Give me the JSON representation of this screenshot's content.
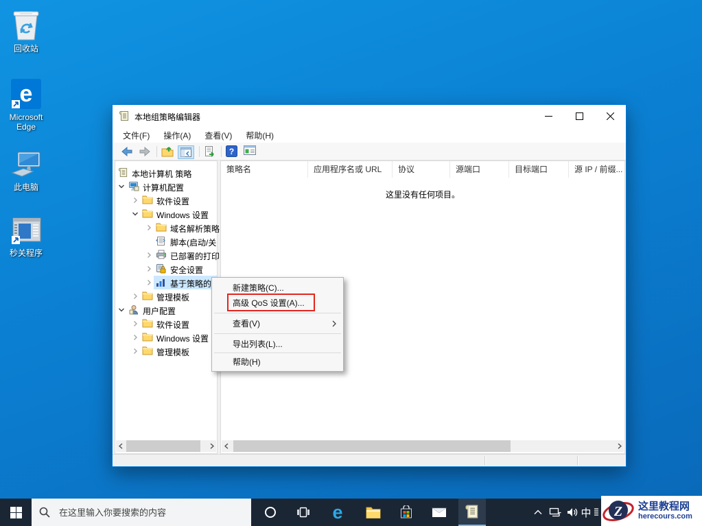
{
  "desktop": {
    "icons": [
      {
        "label": "回收站"
      },
      {
        "label": "Microsoft Edge"
      },
      {
        "label": "此电脑"
      },
      {
        "label": "秒关程序"
      }
    ]
  },
  "window": {
    "title": "本地组策略编辑器",
    "menubar": [
      {
        "label": "文件(F)"
      },
      {
        "label": "操作(A)"
      },
      {
        "label": "查看(V)"
      },
      {
        "label": "帮助(H)"
      }
    ],
    "tree": [
      {
        "label": "本地计算机 策略"
      },
      {
        "label": "计算机配置"
      },
      {
        "label": "软件设置"
      },
      {
        "label": "Windows 设置"
      },
      {
        "label": "域名解析策略"
      },
      {
        "label": "脚本(启动/关"
      },
      {
        "label": "已部署的打印"
      },
      {
        "label": "安全设置"
      },
      {
        "label": "基于策略的"
      },
      {
        "label": "管理模板"
      },
      {
        "label": "用户配置"
      },
      {
        "label": "软件设置"
      },
      {
        "label": "Windows 设置"
      },
      {
        "label": "管理模板"
      }
    ],
    "list": {
      "columns": [
        {
          "label": "策略名"
        },
        {
          "label": "应用程序名或 URL"
        },
        {
          "label": "协议"
        },
        {
          "label": "源端口"
        },
        {
          "label": "目标端口"
        },
        {
          "label": "源 IP / 前缀..."
        }
      ],
      "empty_message": "这里没有任何项目。"
    }
  },
  "context_menu": {
    "items": [
      {
        "label": "新建策略(C)..."
      },
      {
        "label": "高级 QoS 设置(A)..."
      },
      {
        "label": "查看(V)"
      },
      {
        "label": "导出列表(L)..."
      },
      {
        "label": "帮助(H)"
      }
    ]
  },
  "taskbar": {
    "search_placeholder": "在这里输入你要搜索的内容",
    "ime_indicator": "中"
  },
  "watermark": {
    "logo_letter": "Z",
    "site_name": "这里教程网",
    "site_domain": "herecours.com"
  },
  "colors": {
    "accent": "#0078d7",
    "tree_selection": "#cce8ff",
    "annotation_red": "#e2251f",
    "taskbar_bg": "#1b2635"
  }
}
